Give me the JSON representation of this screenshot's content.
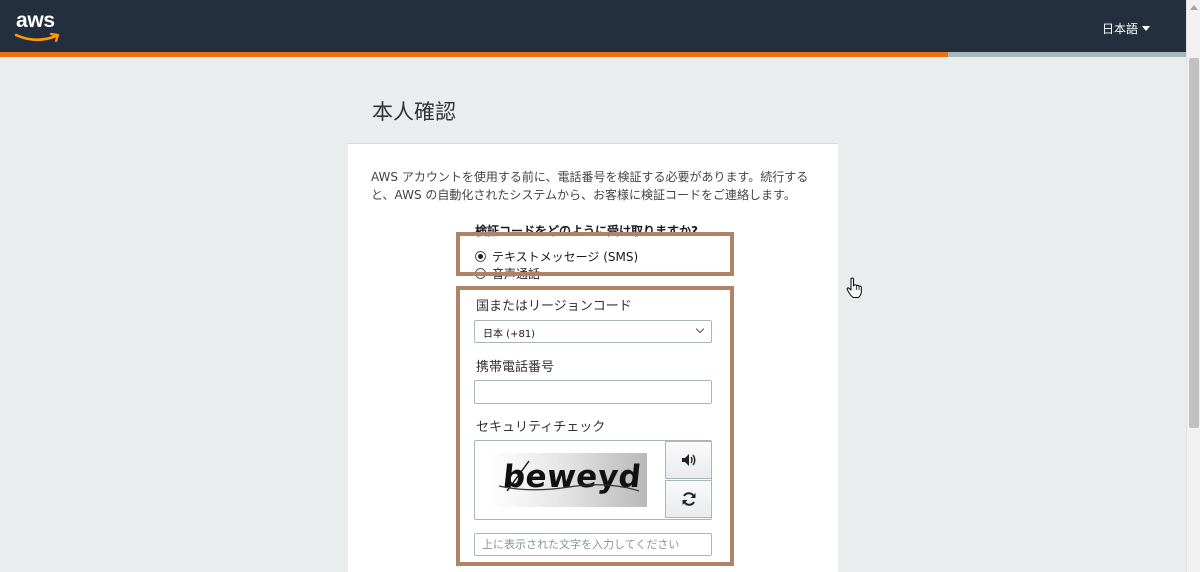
{
  "header": {
    "logo_text": "aws",
    "language_label": "日本語"
  },
  "progress": {
    "fraction": 0.79,
    "color": "#ec7211"
  },
  "page": {
    "title": "本人確認",
    "intro": "AWS アカウントを使用する前に、電話番号を検証する必要があります。続行すると、AWS の自動化されたシステムから、お客様に検証コードをご連絡します。"
  },
  "form": {
    "question": "検証コードをどのように受け取りますか?",
    "options": [
      {
        "label": "テキストメッセージ (SMS)",
        "selected": true
      },
      {
        "label": "音声通話",
        "selected": false
      }
    ],
    "country_label": "国またはリージョンコード",
    "country_value": "日本 (+81)",
    "phone_label": "携帯電話番号",
    "phone_value": "",
    "security_label": "セキュリティチェック",
    "captcha_text": "beweyd",
    "captcha_placeholder": "上に表示された文字を入力してください"
  },
  "colors": {
    "header_bg": "#232f3e",
    "accent": "#ec7211",
    "highlight_border": "#b08366",
    "page_bg": "#eaeded"
  },
  "icons": [
    "aws-smile-icon",
    "caret-down-icon",
    "chevron-down-icon",
    "speaker-icon",
    "refresh-icon",
    "hand-cursor-icon"
  ]
}
